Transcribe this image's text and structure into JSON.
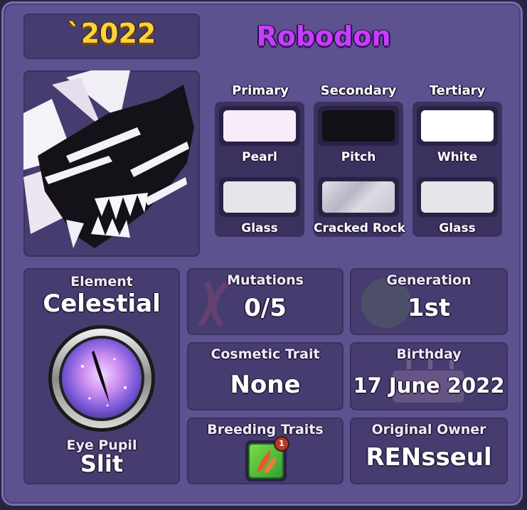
{
  "card": {
    "year": "`2022",
    "name": "Robodon"
  },
  "colors": {
    "headers": [
      "Primary",
      "Secondary",
      "Tertiary"
    ],
    "swatches": [
      {
        "name": "Pearl",
        "color": "#f8ecfa"
      },
      {
        "name": "Pitch",
        "color": "#121016"
      },
      {
        "name": "White",
        "color": "#ffffff"
      },
      {
        "name": "Glass",
        "color": "#e6e6ea"
      },
      {
        "name": "Cracked Rock",
        "color": "#d4d2dc"
      },
      {
        "name": "Glass",
        "color": "#e6e6ea"
      }
    ]
  },
  "element": {
    "label": "Element",
    "value": "Celestial",
    "eye_label": "Eye Pupil",
    "eye_value": "Slit"
  },
  "stats": {
    "mutations_label": "Mutations",
    "mutations_value": "0/5",
    "generation_label": "Generation",
    "generation_value": "1st",
    "cosmetic_label": "Cosmetic Trait",
    "cosmetic_value": "None",
    "birthday_label": "Birthday",
    "birthday_value": "17 June 2022",
    "breeding_label": "Breeding Traits",
    "breeding_badge": "1",
    "owner_label": "Original Owner",
    "owner_value": "RENsseul"
  },
  "icons": {
    "portrait": "dragon-portrait",
    "eye": "celestial-eye-icon",
    "breeding": "breeding-trait-icon"
  }
}
